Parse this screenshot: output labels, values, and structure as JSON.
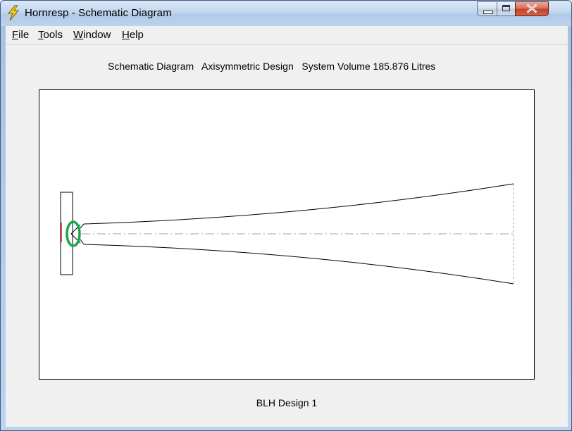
{
  "window": {
    "title": "Hornresp - Schematic Diagram"
  },
  "menu": {
    "items": [
      {
        "key": "F",
        "rest": "ile"
      },
      {
        "key": "T",
        "rest": "ools"
      },
      {
        "key": "W",
        "rest": "indow"
      },
      {
        "key": "H",
        "rest": "elp"
      }
    ]
  },
  "diagram": {
    "heading": "Schematic Diagram   Axisymmetric Design   System Volume 185.876 Litres",
    "design_name": "BLH Design 1"
  },
  "icons": {
    "app": "lightning-bolt-icon",
    "minimize": "minimize-icon",
    "maximize": "maximize-icon",
    "close": "close-icon"
  },
  "colors": {
    "driver_ring": "#1aa54a",
    "source_mark": "#e02020",
    "horn_outline": "#000000",
    "axis_line": "#a0a0a0"
  }
}
